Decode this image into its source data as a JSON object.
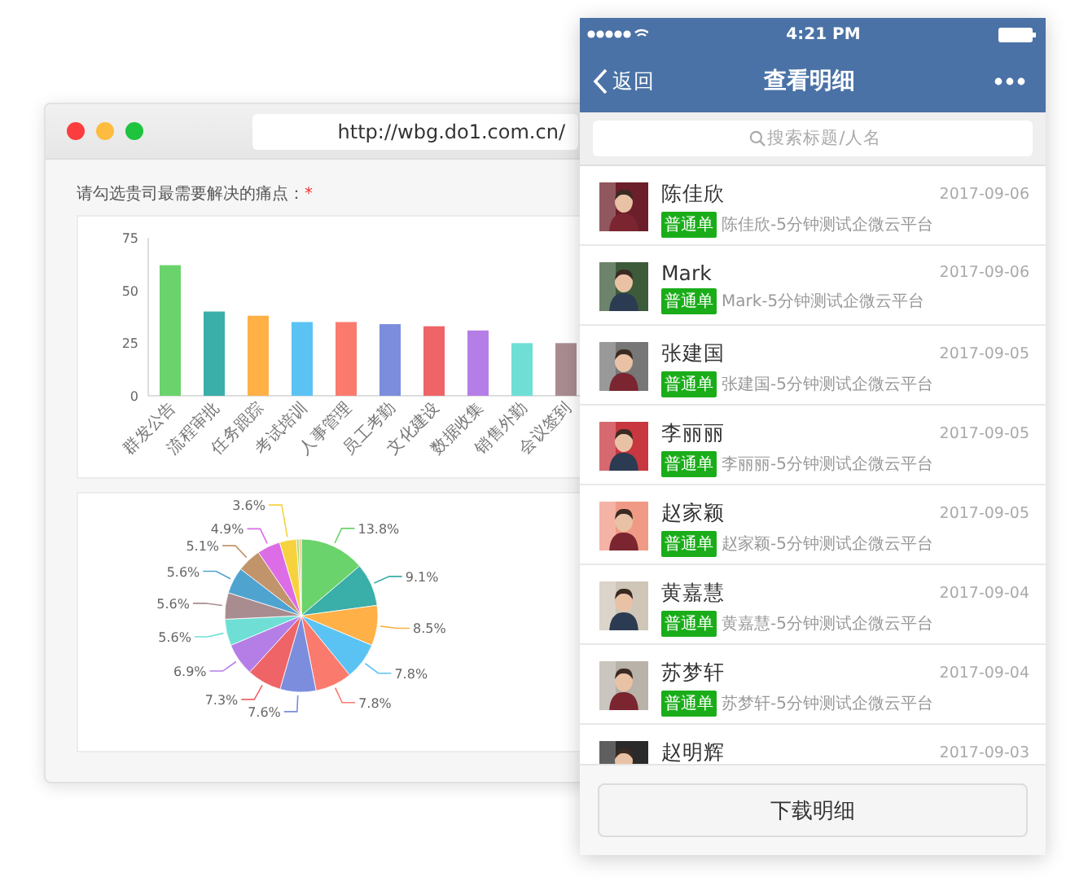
{
  "browser": {
    "url": "http://wbg.do1.com.cn/",
    "question": "请勾选贵司最需要解决的痛点：",
    "required_mark": "*",
    "bar_chart": {
      "chart_data": {
        "type": "bar",
        "categories": [
          "群发公告",
          "流程审批",
          "任务跟踪",
          "考试培训",
          "人事管理",
          "员工考勤",
          "文化建设",
          "数据收集",
          "销售外勤",
          "会议签到"
        ],
        "values": [
          62,
          40,
          38,
          35,
          35,
          34,
          33,
          31,
          25,
          25
        ],
        "ylim": [
          0,
          75
        ],
        "yticks": [
          0,
          25,
          50,
          75
        ],
        "colors": [
          "#6ad36b",
          "#3aaea9",
          "#ffb046",
          "#5bc3f4",
          "#fa7a6e",
          "#7b8ddc",
          "#ef6467",
          "#b57ee6",
          "#6fdfd6",
          "#a98c8f"
        ]
      }
    },
    "pie_chart": {
      "chart_data": {
        "type": "pie",
        "values": [
          13.8,
          9.1,
          8.5,
          7.8,
          7.8,
          7.6,
          7.3,
          6.9,
          5.6,
          5.6,
          5.6,
          5.1,
          4.9,
          3.6,
          0.5,
          0.5
        ],
        "value_labels": [
          "13.8%",
          "9.1%",
          "8.5%",
          "7.8%",
          "7.8%",
          "7.6%",
          "7.3%",
          "6.9%",
          "5.6%",
          "5.6%",
          "5.6%",
          "5.1%",
          "4.9%",
          "3.6%",
          null,
          null
        ],
        "colors": [
          "#6ad36b",
          "#3aaea9",
          "#ffb046",
          "#5bc3f4",
          "#fa7a6e",
          "#7b8ddc",
          "#ef6467",
          "#b57ee6",
          "#6fdfd6",
          "#a98c8f",
          "#4fa3cf",
          "#c1946c",
          "#dc6de6",
          "#f6d33e",
          "#a4d56a",
          "#e8c88d"
        ]
      }
    }
  },
  "phone": {
    "status_bar": {
      "time": "4:21 PM"
    },
    "nav": {
      "back": "返回",
      "title": "查看明细"
    },
    "search": {
      "placeholder": "搜索标题/人名"
    },
    "rows": [
      {
        "name": "陈佳欣",
        "date": "2017-09-06",
        "tag": "普通单",
        "subtitle": "陈佳欣-5分钟测试企微云平台"
      },
      {
        "name": "Mark",
        "date": "2017-09-06",
        "tag": "普通单",
        "subtitle": "Mark-5分钟测试企微云平台"
      },
      {
        "name": "张建国",
        "date": "2017-09-05",
        "tag": "普通单",
        "subtitle": "张建国-5分钟测试企微云平台"
      },
      {
        "name": "李丽丽",
        "date": "2017-09-05",
        "tag": "普通单",
        "subtitle": "李丽丽-5分钟测试企微云平台"
      },
      {
        "name": "赵家颖",
        "date": "2017-09-05",
        "tag": "普通单",
        "subtitle": "赵家颖-5分钟测试企微云平台"
      },
      {
        "name": "黄嘉慧",
        "date": "2017-09-04",
        "tag": "普通单",
        "subtitle": "黄嘉慧-5分钟测试企微云平台"
      },
      {
        "name": "苏梦轩",
        "date": "2017-09-04",
        "tag": "普通单",
        "subtitle": "苏梦轩-5分钟测试企微云平台"
      },
      {
        "name": "赵明辉",
        "date": "2017-09-03"
      }
    ],
    "download_button": "下载明细"
  }
}
